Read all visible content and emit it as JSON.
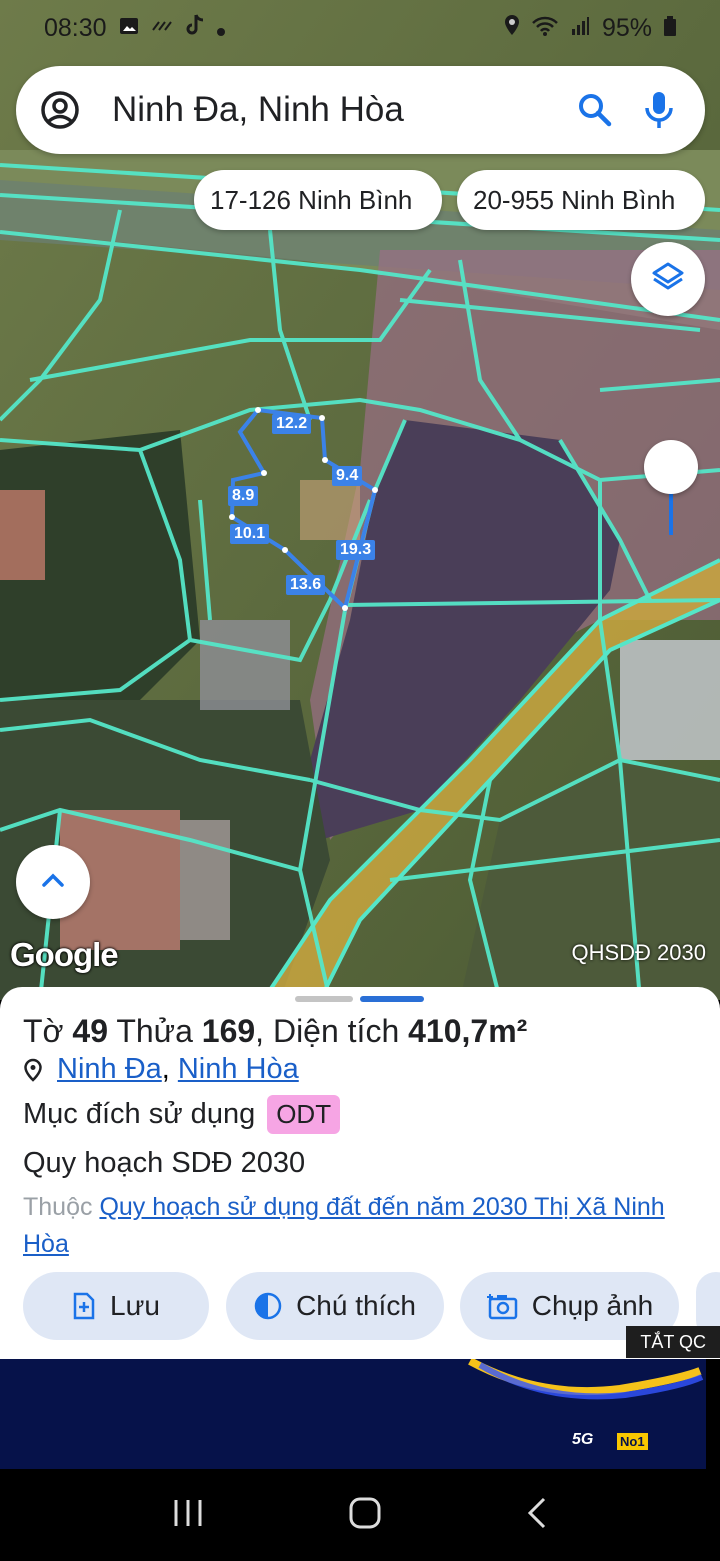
{
  "status_bar": {
    "time": "08:30",
    "battery": "95%"
  },
  "search": {
    "query": "Ninh Đa, Ninh Hòa"
  },
  "chips": [
    {
      "label": "17-126 Ninh Bình"
    },
    {
      "label": "20-955 Ninh Bình"
    }
  ],
  "map": {
    "parcel_edges": [
      "12.2",
      "9.4",
      "8.9",
      "10.1",
      "19.3",
      "13.6"
    ],
    "attribution": "Google",
    "plan_label": "QHSDĐ 2030",
    "colors": {
      "parcel_lines": "#55e6c8",
      "selected_outline": "#3b82e8",
      "road": "#c9a640"
    }
  },
  "sheet": {
    "sheet_label": "Tờ",
    "sheet_no": "49",
    "plot_label": "Thửa",
    "plot_no": "169",
    "area_label": "Diện tích",
    "area_value": "410,7m²",
    "ward": "Ninh Đa",
    "district": "Ninh Hòa",
    "purpose_label": "Mục đích sử dụng",
    "purpose_code": "ODT",
    "plan_title": "Quy hoạch SDĐ 2030",
    "belongs_prefix": "Thuộc",
    "belongs_link": "Quy hoạch sử dụng đất đến năm 2030 Thị Xã Ninh Hòa"
  },
  "actions": {
    "save": "Lưu",
    "legend": "Chú thích",
    "capture": "Chụp ảnh"
  },
  "ad": {
    "close_label": "TẮT QC",
    "label_5g": "5G",
    "label_no1": "No1"
  }
}
